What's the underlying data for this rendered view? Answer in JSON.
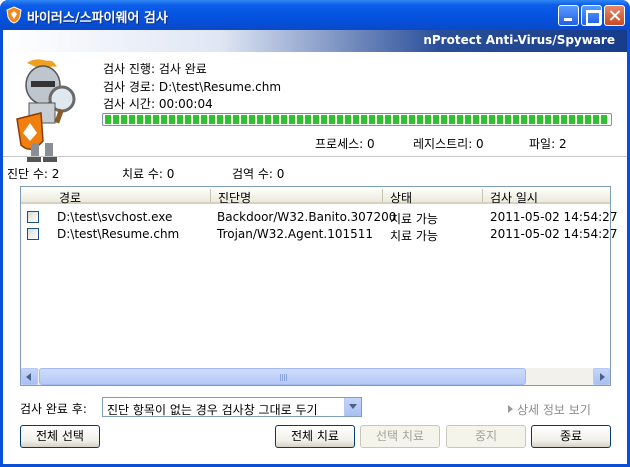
{
  "window": {
    "title": "바이러스/스파이웨어 검사",
    "banner": "nProtect Anti-Virus/Spyware"
  },
  "scan": {
    "progress_label": "검사 진행: 검사 완료",
    "path_label": "검사 경로: D:\\test\\Resume.chm",
    "time_label": "검사 시간: 00:00:04",
    "progress_value": 1.0,
    "process_count": "프로세스: 0",
    "registry_count": "레지스트리: 0",
    "file_count": "파일: 2"
  },
  "stats": {
    "diagnosed": "진단 수: 2",
    "treated": "치료 수: 0",
    "quarantined": "검역 수: 0"
  },
  "table": {
    "columns": [
      "경로",
      "진단명",
      "상태",
      "검사 일시"
    ],
    "rows": [
      {
        "path": "D:\\test\\svchost.exe",
        "name": "Backdoor/W32.Banito.307200",
        "status": "치료 가능",
        "date": "2011-05-02 14:54:27"
      },
      {
        "path": "D:\\test\\Resume.chm",
        "name": "Trojan/W32.Agent.101511",
        "status": "치료 가능",
        "date": "2011-05-02 14:54:27"
      }
    ]
  },
  "after_scan": {
    "label": "검사 완료 후:",
    "selected": "진단 항목이 없는 경우 검사창 그대로 두기"
  },
  "detail_link": "상세 정보 보기",
  "buttons": {
    "select_all": "전체 선택",
    "treat_all": "전체 치료",
    "treat_selected": "선택 치료",
    "stop": "중지",
    "exit": "종료"
  },
  "colors": {
    "titlebar": "#0452de",
    "progress_fill": "#2fc22f"
  }
}
